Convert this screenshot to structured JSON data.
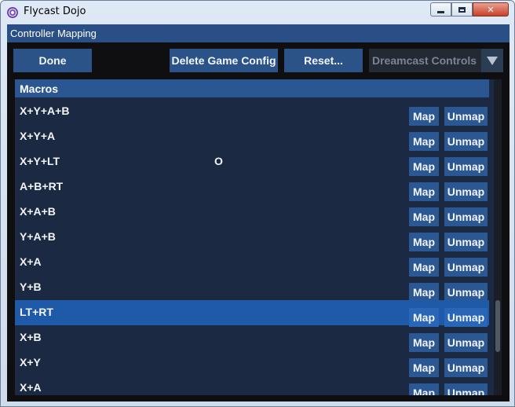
{
  "window": {
    "title": "Flycast Dojo",
    "minimize_icon": "minimize-icon",
    "maximize_icon": "maximize-icon",
    "close_icon": "close-icon",
    "close_glyph": "✕"
  },
  "dialog": {
    "title": "Controller Mapping"
  },
  "toolbar": {
    "done_label": "Done",
    "delete_label": "Delete Game Config",
    "reset_label": "Reset...",
    "controls_select": {
      "value": "Dreamcast Controls",
      "icon": "chevron-down-icon"
    }
  },
  "list": {
    "section": "Macros",
    "map_label": "Map",
    "unmap_label": "Unmap",
    "rows": [
      {
        "label": "X+Y+A+B",
        "value": ""
      },
      {
        "label": "X+Y+A",
        "value": ""
      },
      {
        "label": "X+Y+LT",
        "value": "O"
      },
      {
        "label": "A+B+RT",
        "value": ""
      },
      {
        "label": "X+A+B",
        "value": ""
      },
      {
        "label": "Y+A+B",
        "value": ""
      },
      {
        "label": "X+A",
        "value": ""
      },
      {
        "label": "Y+B",
        "value": ""
      },
      {
        "label": "LT+RT",
        "value": "",
        "selected": true
      },
      {
        "label": "X+B",
        "value": ""
      },
      {
        "label": "X+Y",
        "value": ""
      },
      {
        "label": "X+A",
        "value": ""
      }
    ]
  },
  "colors": {
    "accent": "#2a5792",
    "selected_row": "#1f5aa8",
    "list_bg": "#1c2942"
  }
}
